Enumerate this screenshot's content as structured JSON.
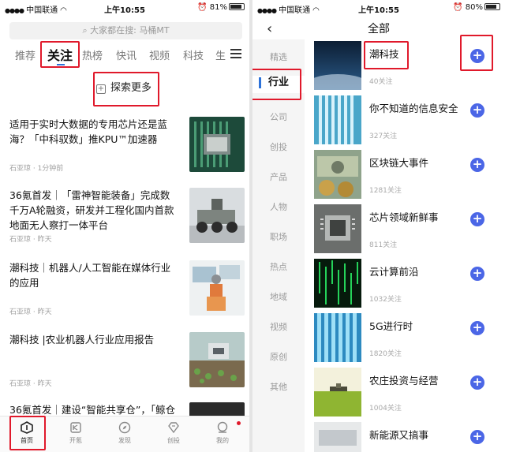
{
  "status_left": {
    "carrier": "中国联通",
    "time": "上午10:55",
    "battery": "81%",
    "battery_level": 0.81
  },
  "status_right": {
    "carrier": "中国联通",
    "time": "上午10:55",
    "battery": "80%",
    "battery_level": 0.8
  },
  "search": {
    "placeholder": "大家都在搜: 马桶MT"
  },
  "tabs": [
    "推荐",
    "关注",
    "热榜",
    "快讯",
    "视频",
    "科技",
    "生"
  ],
  "explore_label": "探索更多",
  "articles": [
    {
      "title": "适用于实时大数据的专用芯片还是蓝海？「中科驭数」推KPU™加速器",
      "meta": "石亚琼 · 1分钟前"
    },
    {
      "title": "36氪首发｜「雷神智能装备」完成数千万A轮融资，研发并工程化国内首款地面无人察打一体平台",
      "meta": "石亚琼 · 昨天"
    },
    {
      "title": "潮科技｜机器人/人工智能在媒体行业的应用",
      "meta": "石亚琼 · 昨天"
    },
    {
      "title": "潮科技 |农业机器人行业应用报告",
      "meta": "石亚琼 · 昨天"
    },
    {
      "title": "36氪首发｜建设“智能共享仓”，「鲸仓",
      "meta": ""
    }
  ],
  "bottom_nav": [
    "首页",
    "开氪",
    "发现",
    "创投",
    "我的"
  ],
  "right": {
    "title": "全部",
    "categories": [
      "精选",
      "行业",
      "公司",
      "创投",
      "产品",
      "人物",
      "职场",
      "热点",
      "地域",
      "视频",
      "原创",
      "其他"
    ],
    "topics": [
      {
        "name": "潮科技",
        "count": "40关注"
      },
      {
        "name": "你不知道的信息安全",
        "count": "327关注"
      },
      {
        "name": "区块链大事件",
        "count": "1281关注"
      },
      {
        "name": "芯片领域新鲜事",
        "count": "811关注"
      },
      {
        "name": "云计算前沿",
        "count": "1032关注"
      },
      {
        "name": "5G进行时",
        "count": "1820关注"
      },
      {
        "name": "农庄投资与经营",
        "count": "1004关注"
      },
      {
        "name": "新能源又搞事",
        "count": ""
      }
    ],
    "add_symbol": "+"
  },
  "colors": {
    "accent": "#2d72d9",
    "highlight_box": "#e0192b",
    "add_button": "#4b66e6"
  }
}
